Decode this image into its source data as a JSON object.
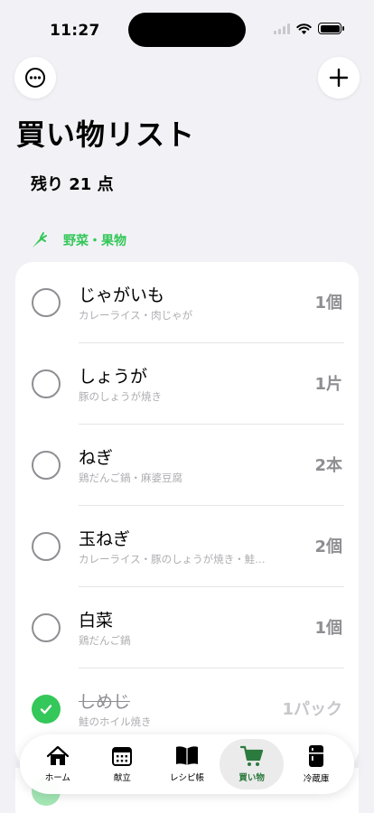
{
  "status_bar": {
    "time": "11:27"
  },
  "header": {
    "title": "買い物リスト",
    "remaining": "残り 21 点"
  },
  "category": {
    "label": "野菜・果物"
  },
  "items": [
    {
      "name": "じゃがいも",
      "sub": "カレーライス・肉じゃが",
      "qty": "1個",
      "checked": false
    },
    {
      "name": "しょうが",
      "sub": "豚のしょうが焼き",
      "qty": "1片",
      "checked": false
    },
    {
      "name": "ねぎ",
      "sub": "鶏だんご鍋・麻婆豆腐",
      "qty": "2本",
      "checked": false
    },
    {
      "name": "玉ねぎ",
      "sub": "カレーライス・豚のしょうが焼き・鮭…",
      "qty": "2個",
      "checked": false
    },
    {
      "name": "白菜",
      "sub": "鶏だんご鍋",
      "qty": "1個",
      "checked": false
    },
    {
      "name": "しめじ",
      "sub": "鮭のホイル焼き",
      "qty": "1パック",
      "checked": true
    }
  ],
  "tabbar": {
    "tabs": [
      {
        "label": "ホーム",
        "icon": "house-icon"
      },
      {
        "label": "献立",
        "icon": "calendar-icon"
      },
      {
        "label": "レシピ帳",
        "icon": "book-icon"
      },
      {
        "label": "買い物",
        "icon": "cart-icon",
        "active": true
      },
      {
        "label": "冷蔵庫",
        "icon": "fridge-icon"
      }
    ]
  },
  "colors": {
    "accent": "#34c759",
    "active_tab": "#2b7a3e",
    "background": "#f2f2f6"
  }
}
